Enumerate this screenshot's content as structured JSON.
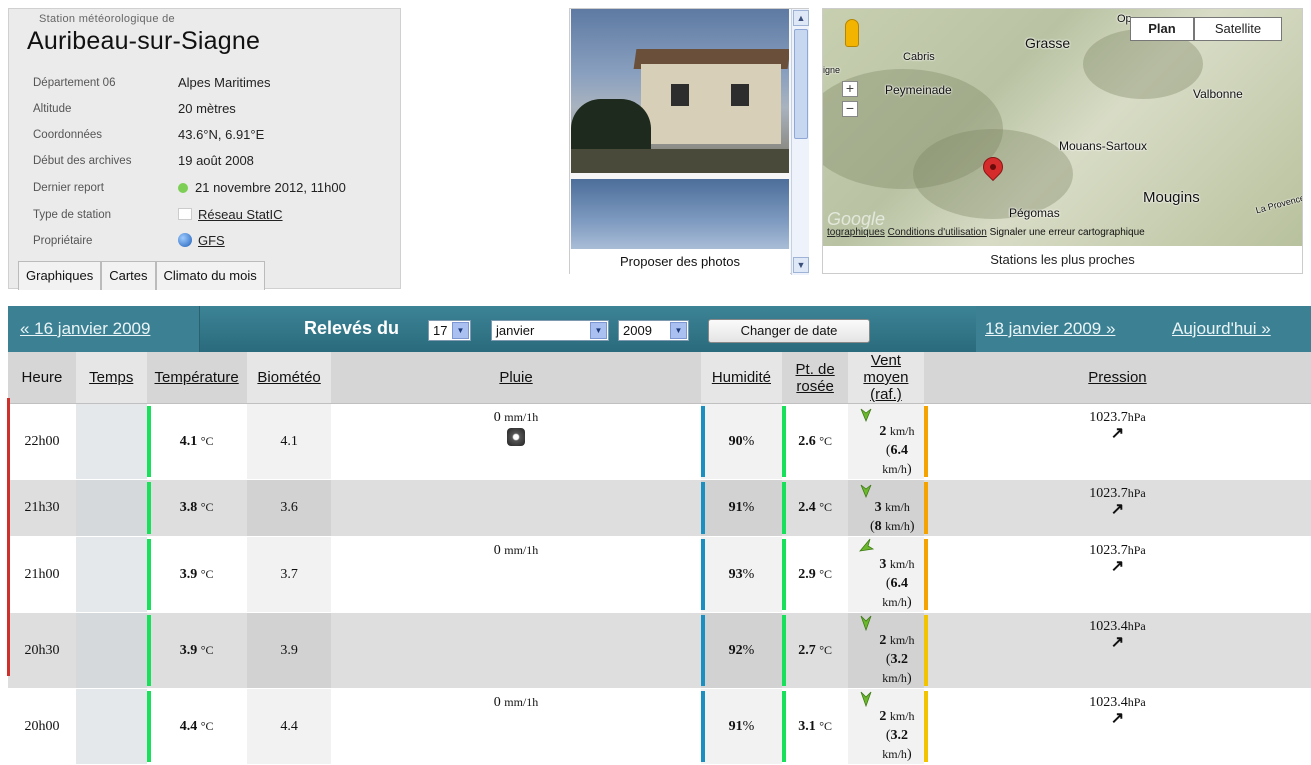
{
  "station": {
    "pretitle": "Station météorologique de",
    "name": "Auribeau-sur-Siagne",
    "fields": [
      {
        "label": "Département 06",
        "value": "Alpes Maritimes"
      },
      {
        "label": "Altitude",
        "value": "20 mètres"
      },
      {
        "label": "Coordonnées",
        "value": "43.6°N, 6.91°E"
      },
      {
        "label": "Début des archives",
        "value": "19 août 2008"
      },
      {
        "label": "Dernier report",
        "value": "21 novembre 2012, 11h00"
      },
      {
        "label": "Type de station",
        "value": "Réseau StatIC"
      },
      {
        "label": "Propriétaire",
        "value": "GFS"
      }
    ],
    "tabs": [
      "Graphiques",
      "Cartes",
      "Climato du mois"
    ]
  },
  "photos": {
    "caption": "Proposer des photos"
  },
  "map": {
    "plan_label": "Plan",
    "satellite_label": "Satellite",
    "towns": [
      "Grasse",
      "Cabris",
      "Peymeinade",
      "Valbonne",
      "Mouans-Sartoux",
      "Mougins",
      "Pégomas",
      "La Provence",
      "Op",
      "igne"
    ],
    "credits_link1": "tographiques",
    "credits_link2": "Conditions d'utilisation",
    "credits_text": "Signaler une erreur cartographique",
    "caption": "Stations les plus proches",
    "google": "Google"
  },
  "datebar": {
    "prev_link": "« 16 janvier 2009",
    "releves_label": "Relevés du",
    "day": "17",
    "month": "janvier",
    "year": "2009",
    "change_button": "Changer de date",
    "next_link": "18 janvier 2009 »",
    "today_link": "Aujourd'hui »"
  },
  "table": {
    "headers": [
      "Heure",
      "Temps",
      "Température",
      "Biométéo",
      "Pluie",
      "Humidité",
      "Pt. de rosée",
      "Vent moyen",
      "(raf.)",
      "Pression"
    ],
    "rows": [
      {
        "heure": "22h00",
        "temp": "4.1",
        "bio": "4.1",
        "pluie": "0",
        "hum": "90",
        "rosee": "2.6",
        "vent": "2",
        "rafale": "6.4",
        "pression": "1023.7"
      },
      {
        "heure": "21h30",
        "temp": "3.8",
        "bio": "3.6",
        "pluie": "",
        "hum": "91",
        "rosee": "2.4",
        "vent": "3",
        "rafale": "8",
        "pression": "1023.7"
      },
      {
        "heure": "21h00",
        "temp": "3.9",
        "bio": "3.7",
        "pluie": "0",
        "hum": "93",
        "rosee": "2.9",
        "vent": "3",
        "rafale": "6.4",
        "pression": "1023.7"
      },
      {
        "heure": "20h30",
        "temp": "3.9",
        "bio": "3.9",
        "pluie": "",
        "hum": "92",
        "rosee": "2.7",
        "vent": "2",
        "rafale": "3.2",
        "pression": "1023.4"
      },
      {
        "heure": "20h00",
        "temp": "4.4",
        "bio": "4.4",
        "pluie": "0",
        "hum": "91",
        "rosee": "3.1",
        "vent": "2",
        "rafale": "3.2",
        "pression": "1023.4"
      }
    ],
    "units": {
      "temp": "°C",
      "rain": "mm/1h",
      "hum": "%",
      "wind": "km/h",
      "press": "hPa"
    },
    "colors": {
      "temp_bar": "#19e05a",
      "hum_bar": "#1a8fc0",
      "press_bar_1": "#f5a300",
      "press_bar_2": "#f2c400",
      "red_bar": "#d0302a"
    }
  }
}
